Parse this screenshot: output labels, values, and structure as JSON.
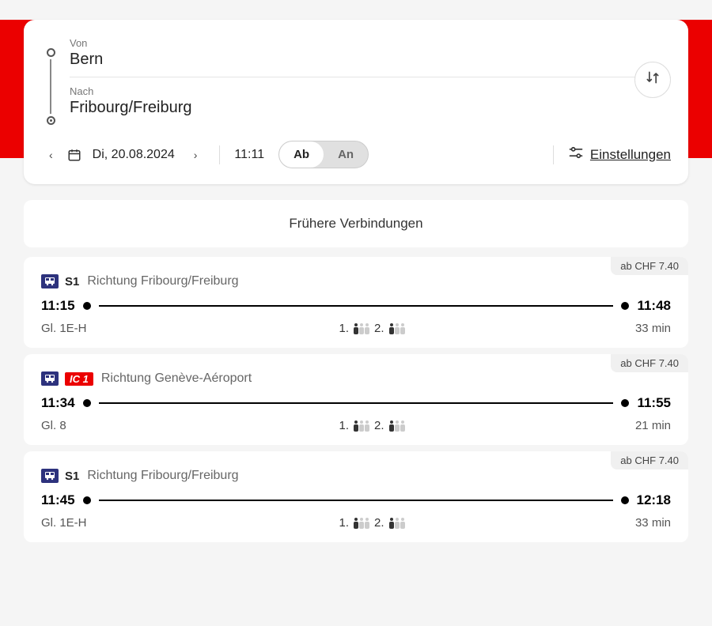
{
  "search": {
    "from_label": "Von",
    "from_value": "Bern",
    "to_label": "Nach",
    "to_value": "Fribourg/Freiburg",
    "date": "Di, 20.08.2024",
    "time": "11:11",
    "toggle_ab": "Ab",
    "toggle_an": "An",
    "settings": "Einstellungen"
  },
  "earlier_label": "Frühere Verbindungen",
  "connections": [
    {
      "price": "ab CHF 7.40",
      "line": "S1",
      "badge": null,
      "direction": "Richtung Fribourg/Freiburg",
      "dep": "11:15",
      "arr": "11:48",
      "platform": "Gl. 1E-H",
      "occ1": [
        true,
        false,
        false
      ],
      "occ2": [
        true,
        false,
        false
      ],
      "duration": "33 min"
    },
    {
      "price": "ab CHF 7.40",
      "line": null,
      "badge": "IC 1",
      "direction": "Richtung Genève-Aéroport",
      "dep": "11:34",
      "arr": "11:55",
      "platform": "Gl. 8",
      "occ1": [
        true,
        false,
        false
      ],
      "occ2": [
        true,
        false,
        false
      ],
      "duration": "21 min"
    },
    {
      "price": "ab CHF 7.40",
      "line": "S1",
      "badge": null,
      "direction": "Richtung Fribourg/Freiburg",
      "dep": "11:45",
      "arr": "12:18",
      "platform": "Gl. 1E-H",
      "occ1": [
        true,
        false,
        false
      ],
      "occ2": [
        true,
        false,
        false
      ],
      "duration": "33 min"
    }
  ],
  "occ_labels": {
    "first": "1.",
    "second": "2."
  }
}
